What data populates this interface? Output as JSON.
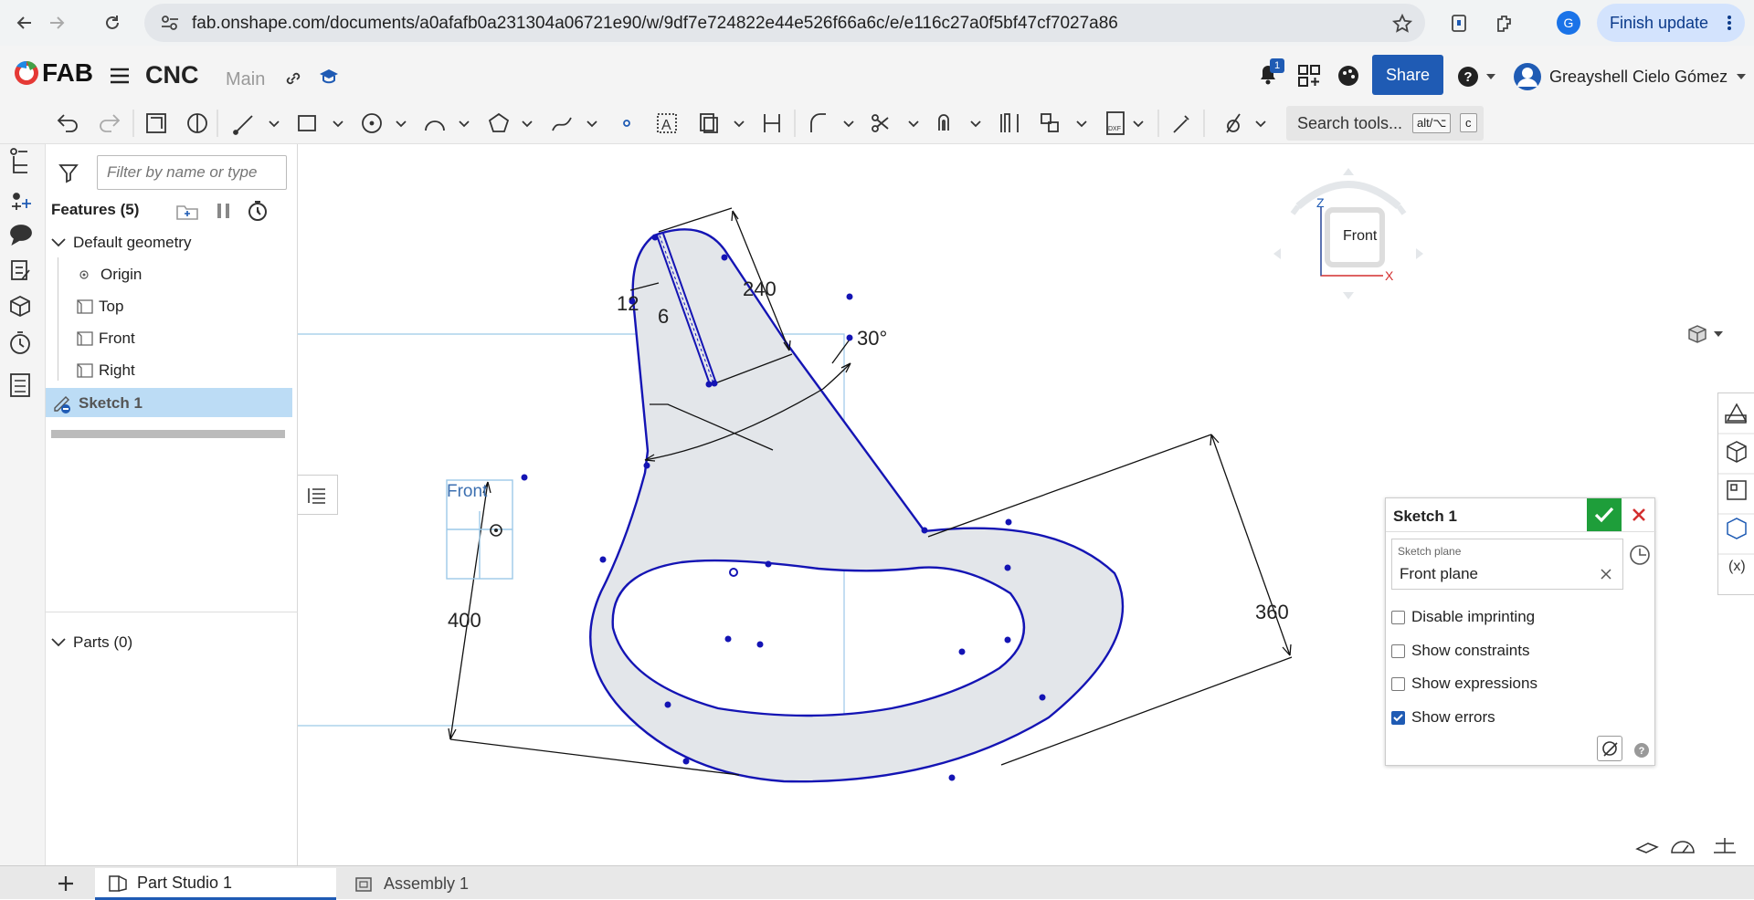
{
  "browser": {
    "url": "fab.onshape.com/documents/a0afafb0a231304a06721e90/w/9df7e724822e44e526f66a6c/e/e116c27a0f5bf47cf7027a86",
    "profile_initial": "G",
    "finish_update": "Finish update"
  },
  "header": {
    "logo_text": "FAB",
    "document_name": "CNC",
    "branch": "Main",
    "notification_count": "1",
    "share_label": "Share",
    "user_name": "Greayshell Cielo Gómez"
  },
  "toolbar": {
    "search_label": "Search tools...",
    "shortcut_mod": "alt/⌥",
    "shortcut_key": "c"
  },
  "feature_panel": {
    "filter_placeholder": "Filter by name or type",
    "features_label": "Features (5)",
    "default_geometry": "Default geometry",
    "items": [
      "Origin",
      "Top",
      "Front",
      "Right"
    ],
    "sketch": "Sketch 1",
    "parts_label": "Parts (0)"
  },
  "canvas": {
    "dimensions": [
      "12",
      "6",
      "240",
      "30°",
      "400",
      "360"
    ],
    "plane_label": "Front",
    "view_cube": {
      "face": "Front",
      "axis_z": "Z",
      "axis_x": "X"
    }
  },
  "sketch_dialog": {
    "title": "Sketch 1",
    "plane_label": "Sketch plane",
    "plane_value": "Front plane",
    "options": [
      {
        "label": "Disable imprinting",
        "checked": false
      },
      {
        "label": "Show constraints",
        "checked": false
      },
      {
        "label": "Show expressions",
        "checked": false
      },
      {
        "label": "Show errors",
        "checked": true
      }
    ]
  },
  "tabs": {
    "part_studio": "Part Studio 1",
    "assembly": "Assembly 1"
  },
  "colors": {
    "sketch_line": "#1414b4",
    "region_fill": "#e3e6ea",
    "share": "#1f5bb4",
    "accept": "#1e9e3a",
    "cancel": "#d32f2f",
    "selection": "#bcdcf5"
  }
}
